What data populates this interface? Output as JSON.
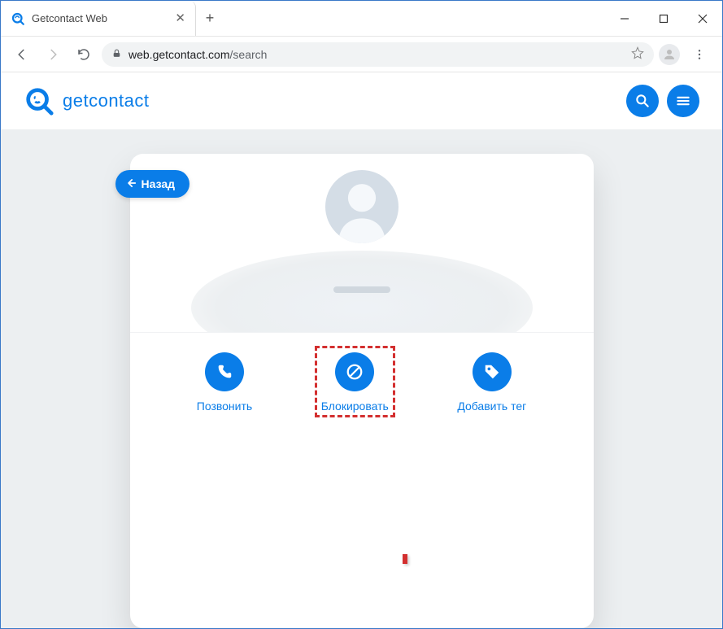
{
  "browser": {
    "tab_title": "Getcontact Web",
    "url_host": "web.getcontact.com",
    "url_path": "/search"
  },
  "site": {
    "brand": "getcontact"
  },
  "card": {
    "back_label": "Назад",
    "actions": {
      "call": "Позвонить",
      "block": "Блокировать",
      "add_tag": "Добавить тег"
    }
  }
}
